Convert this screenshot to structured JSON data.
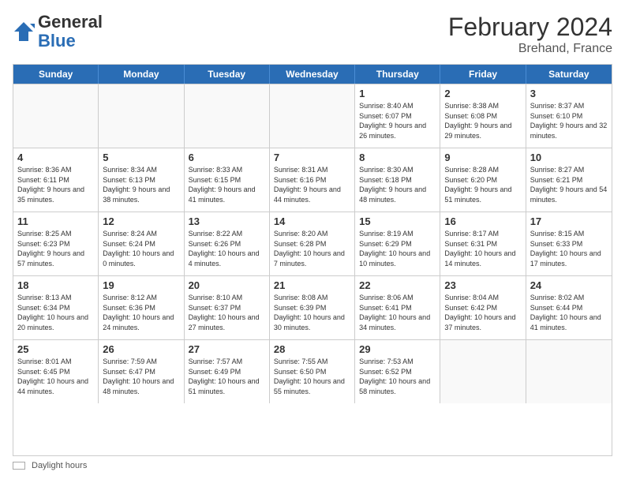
{
  "header": {
    "logo_general": "General",
    "logo_blue": "Blue",
    "main_title": "February 2024",
    "subtitle": "Brehand, France"
  },
  "calendar": {
    "days_of_week": [
      "Sunday",
      "Monday",
      "Tuesday",
      "Wednesday",
      "Thursday",
      "Friday",
      "Saturday"
    ],
    "weeks": [
      [
        {
          "day": "",
          "info": ""
        },
        {
          "day": "",
          "info": ""
        },
        {
          "day": "",
          "info": ""
        },
        {
          "day": "",
          "info": ""
        },
        {
          "day": "1",
          "info": "Sunrise: 8:40 AM\nSunset: 6:07 PM\nDaylight: 9 hours and 26 minutes."
        },
        {
          "day": "2",
          "info": "Sunrise: 8:38 AM\nSunset: 6:08 PM\nDaylight: 9 hours and 29 minutes."
        },
        {
          "day": "3",
          "info": "Sunrise: 8:37 AM\nSunset: 6:10 PM\nDaylight: 9 hours and 32 minutes."
        }
      ],
      [
        {
          "day": "4",
          "info": "Sunrise: 8:36 AM\nSunset: 6:11 PM\nDaylight: 9 hours and 35 minutes."
        },
        {
          "day": "5",
          "info": "Sunrise: 8:34 AM\nSunset: 6:13 PM\nDaylight: 9 hours and 38 minutes."
        },
        {
          "day": "6",
          "info": "Sunrise: 8:33 AM\nSunset: 6:15 PM\nDaylight: 9 hours and 41 minutes."
        },
        {
          "day": "7",
          "info": "Sunrise: 8:31 AM\nSunset: 6:16 PM\nDaylight: 9 hours and 44 minutes."
        },
        {
          "day": "8",
          "info": "Sunrise: 8:30 AM\nSunset: 6:18 PM\nDaylight: 9 hours and 48 minutes."
        },
        {
          "day": "9",
          "info": "Sunrise: 8:28 AM\nSunset: 6:20 PM\nDaylight: 9 hours and 51 minutes."
        },
        {
          "day": "10",
          "info": "Sunrise: 8:27 AM\nSunset: 6:21 PM\nDaylight: 9 hours and 54 minutes."
        }
      ],
      [
        {
          "day": "11",
          "info": "Sunrise: 8:25 AM\nSunset: 6:23 PM\nDaylight: 9 hours and 57 minutes."
        },
        {
          "day": "12",
          "info": "Sunrise: 8:24 AM\nSunset: 6:24 PM\nDaylight: 10 hours and 0 minutes."
        },
        {
          "day": "13",
          "info": "Sunrise: 8:22 AM\nSunset: 6:26 PM\nDaylight: 10 hours and 4 minutes."
        },
        {
          "day": "14",
          "info": "Sunrise: 8:20 AM\nSunset: 6:28 PM\nDaylight: 10 hours and 7 minutes."
        },
        {
          "day": "15",
          "info": "Sunrise: 8:19 AM\nSunset: 6:29 PM\nDaylight: 10 hours and 10 minutes."
        },
        {
          "day": "16",
          "info": "Sunrise: 8:17 AM\nSunset: 6:31 PM\nDaylight: 10 hours and 14 minutes."
        },
        {
          "day": "17",
          "info": "Sunrise: 8:15 AM\nSunset: 6:33 PM\nDaylight: 10 hours and 17 minutes."
        }
      ],
      [
        {
          "day": "18",
          "info": "Sunrise: 8:13 AM\nSunset: 6:34 PM\nDaylight: 10 hours and 20 minutes."
        },
        {
          "day": "19",
          "info": "Sunrise: 8:12 AM\nSunset: 6:36 PM\nDaylight: 10 hours and 24 minutes."
        },
        {
          "day": "20",
          "info": "Sunrise: 8:10 AM\nSunset: 6:37 PM\nDaylight: 10 hours and 27 minutes."
        },
        {
          "day": "21",
          "info": "Sunrise: 8:08 AM\nSunset: 6:39 PM\nDaylight: 10 hours and 30 minutes."
        },
        {
          "day": "22",
          "info": "Sunrise: 8:06 AM\nSunset: 6:41 PM\nDaylight: 10 hours and 34 minutes."
        },
        {
          "day": "23",
          "info": "Sunrise: 8:04 AM\nSunset: 6:42 PM\nDaylight: 10 hours and 37 minutes."
        },
        {
          "day": "24",
          "info": "Sunrise: 8:02 AM\nSunset: 6:44 PM\nDaylight: 10 hours and 41 minutes."
        }
      ],
      [
        {
          "day": "25",
          "info": "Sunrise: 8:01 AM\nSunset: 6:45 PM\nDaylight: 10 hours and 44 minutes."
        },
        {
          "day": "26",
          "info": "Sunrise: 7:59 AM\nSunset: 6:47 PM\nDaylight: 10 hours and 48 minutes."
        },
        {
          "day": "27",
          "info": "Sunrise: 7:57 AM\nSunset: 6:49 PM\nDaylight: 10 hours and 51 minutes."
        },
        {
          "day": "28",
          "info": "Sunrise: 7:55 AM\nSunset: 6:50 PM\nDaylight: 10 hours and 55 minutes."
        },
        {
          "day": "29",
          "info": "Sunrise: 7:53 AM\nSunset: 6:52 PM\nDaylight: 10 hours and 58 minutes."
        },
        {
          "day": "",
          "info": ""
        },
        {
          "day": "",
          "info": ""
        }
      ]
    ]
  },
  "footer": {
    "legend_label": "Daylight hours"
  }
}
